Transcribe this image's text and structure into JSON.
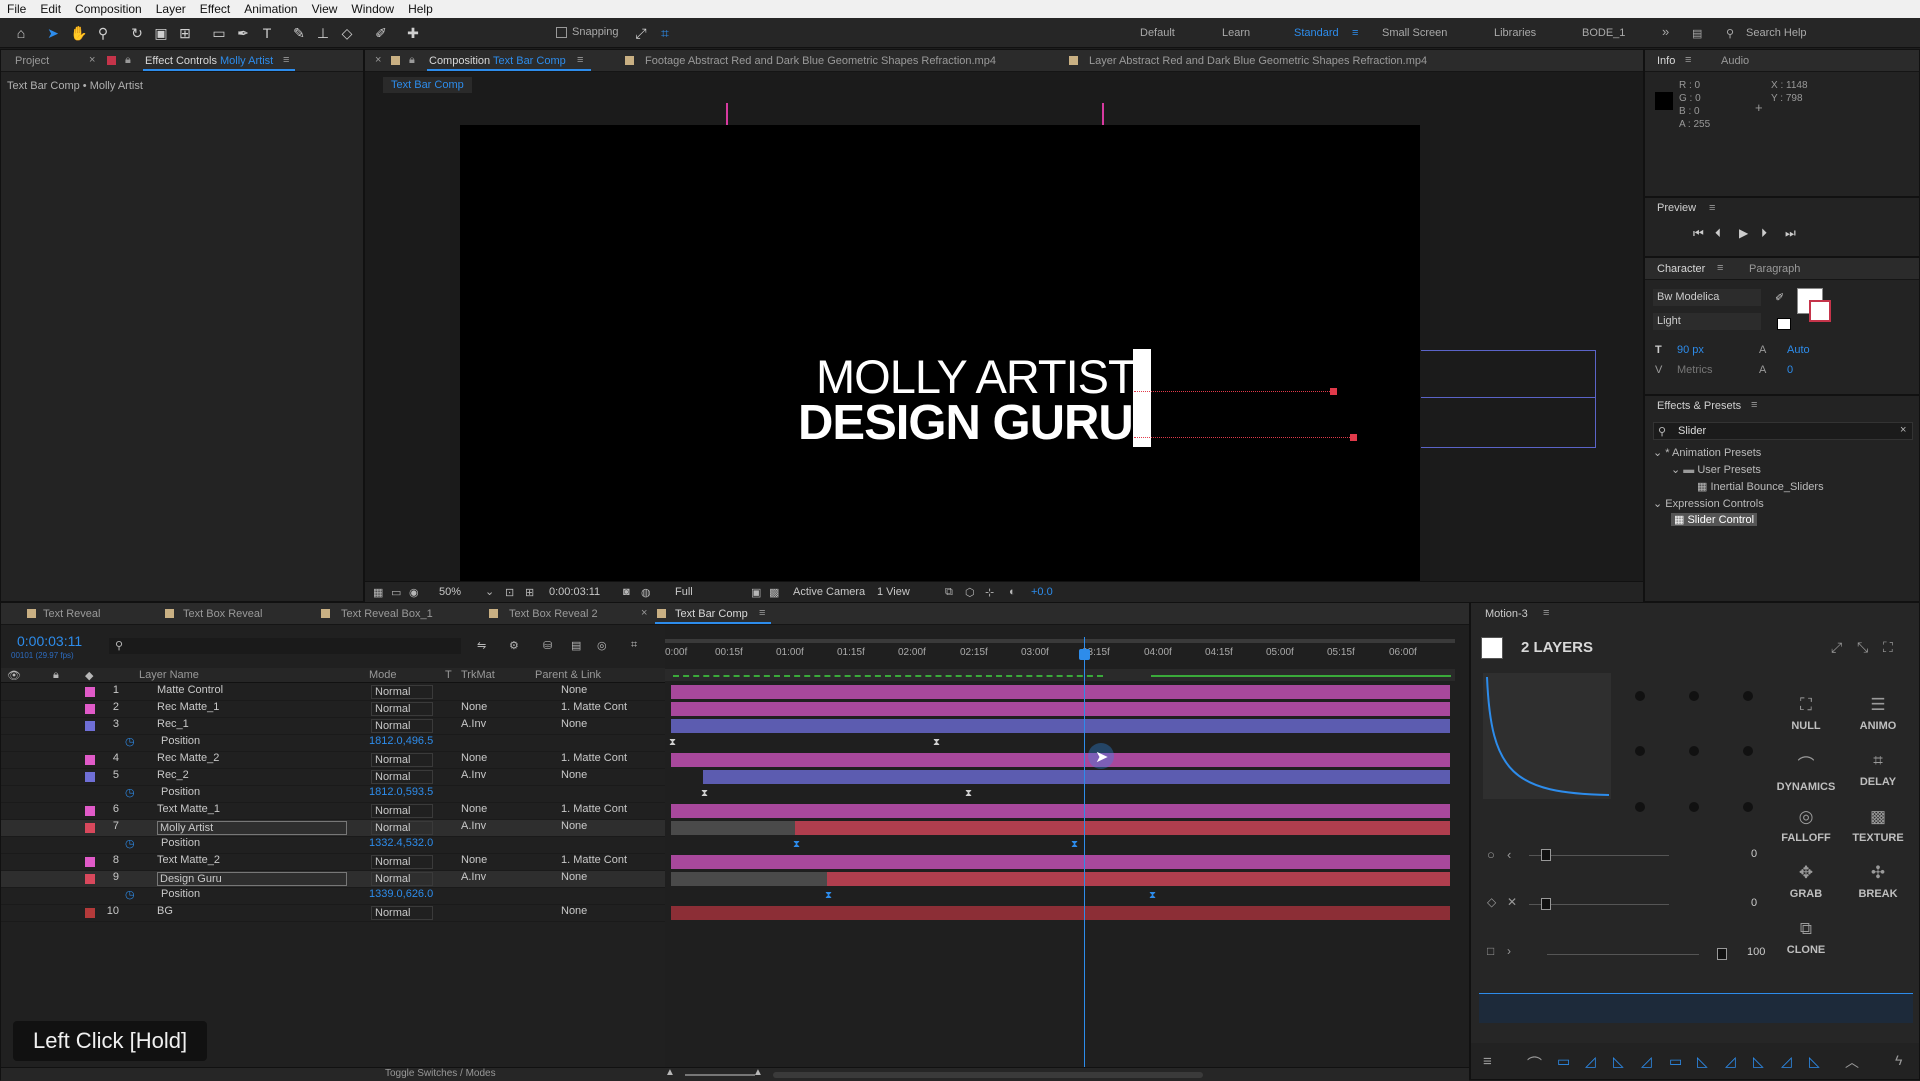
{
  "menu": [
    "File",
    "Edit",
    "Composition",
    "Layer",
    "Effect",
    "Animation",
    "View",
    "Window",
    "Help"
  ],
  "toolbar": {
    "snapping_label": "Snapping",
    "workspaces": [
      "Default",
      "Learn",
      "Standard",
      "Small Screen",
      "Libraries",
      "BODE_1"
    ],
    "active_workspace": "Standard",
    "search_placeholder": "Search Help"
  },
  "left_panel": {
    "tab_project": "Project",
    "tab_effect_controls": "Effect Controls",
    "effect_layer": "Molly Artist",
    "breadcrumb": "Text Bar Comp • Molly Artist"
  },
  "viewer": {
    "tab_composition": "Composition",
    "comp_name": "Text Bar Comp",
    "tab_footage": "Footage  Abstract Red and Dark Blue Geometric Shapes Refraction.mp4",
    "tab_layer": "Layer  Abstract Red and Dark Blue Geometric Shapes Refraction.mp4",
    "subtab": "Text Bar Comp",
    "line1": "MOLLY ARTIST",
    "line2": "DESIGN GURU",
    "zoom": "50%",
    "timecode": "0:00:03:11",
    "resolution": "Full",
    "camera": "Active Camera",
    "views": "1 View",
    "exposure": "+0.0"
  },
  "info": {
    "tab_info": "Info",
    "tab_audio": "Audio",
    "r": "R : 0",
    "g": "G : 0",
    "b": "B : 0",
    "a": "A : 255",
    "x": "X : 1148",
    "y": "Y : 798"
  },
  "preview": {
    "title": "Preview"
  },
  "character": {
    "tab_character": "Character",
    "tab_paragraph": "Paragraph",
    "font": "Bw Modelica",
    "style": "Light",
    "size": "90 px",
    "leading": "Auto",
    "kerning": "Metrics",
    "tracking": "0"
  },
  "effects": {
    "title": "Effects & Presets",
    "search": "Slider",
    "tree": [
      {
        "label": "* Animation Presets",
        "indent": 0
      },
      {
        "label": "User Presets",
        "indent": 1
      },
      {
        "label": "Inertial Bounce_Sliders",
        "indent": 2
      },
      {
        "label": "Expression Controls",
        "indent": 0
      },
      {
        "label": "Slider Control",
        "indent": 1
      }
    ]
  },
  "timeline": {
    "tabs": [
      "Text Reveal",
      "Text Box Reveal",
      "Text Reveal Box_1",
      "Text Box Reveal 2",
      "Text Bar Comp"
    ],
    "active_tab": "Text Bar Comp",
    "timecode": "0:00:03:11",
    "fps": "00101 (29.97 fps)",
    "col_layer_name": "Layer Name",
    "col_mode": "Mode",
    "col_t": "T",
    "col_trkmat": "TrkMat",
    "col_parent": "Parent & Link",
    "ruler": [
      "0:00f",
      "00:15f",
      "01:00f",
      "01:15f",
      "02:00f",
      "02:15f",
      "03:00f",
      "03:15f",
      "04:00f",
      "04:15f",
      "05:00f",
      "05:15f",
      "06:00f"
    ],
    "layers": [
      {
        "num": "1",
        "name": "Matte Control",
        "mode": "Normal",
        "trk": "",
        "parent": "None",
        "color": "#e05ac8",
        "type": "layer"
      },
      {
        "num": "2",
        "name": "Rec Matte_1",
        "mode": "Normal",
        "trk": "None",
        "parent": "1. Matte Cont",
        "color": "#e05ac8",
        "type": "layer"
      },
      {
        "num": "3",
        "name": "Rec_1",
        "mode": "Normal",
        "trk": "A.Inv",
        "parent": "None",
        "color": "#6f6fd6",
        "type": "layer"
      },
      {
        "num": "",
        "name": "Position",
        "value": "1812.0,496.5",
        "type": "prop"
      },
      {
        "num": "4",
        "name": "Rec Matte_2",
        "mode": "Normal",
        "trk": "None",
        "parent": "1. Matte Cont",
        "color": "#e05ac8",
        "type": "layer"
      },
      {
        "num": "5",
        "name": "Rec_2",
        "mode": "Normal",
        "trk": "A.Inv",
        "parent": "None",
        "color": "#6f6fd6",
        "type": "layer"
      },
      {
        "num": "",
        "name": "Position",
        "value": "1812.0,593.5",
        "type": "prop"
      },
      {
        "num": "6",
        "name": "Text Matte_1",
        "mode": "Normal",
        "trk": "None",
        "parent": "1. Matte Cont",
        "color": "#e05ac8",
        "type": "layer"
      },
      {
        "num": "7",
        "name": "Molly Artist",
        "mode": "Normal",
        "trk": "A.Inv",
        "parent": "None",
        "color": "#d8485c",
        "type": "layer"
      },
      {
        "num": "",
        "name": "Position",
        "value": "1332.4,532.0",
        "type": "prop"
      },
      {
        "num": "8",
        "name": "Text Matte_2",
        "mode": "Normal",
        "trk": "None",
        "parent": "1. Matte Cont",
        "color": "#e05ac8",
        "type": "layer"
      },
      {
        "num": "9",
        "name": "Design Guru",
        "mode": "Normal",
        "trk": "A.Inv",
        "parent": "None",
        "color": "#d8485c",
        "type": "layer"
      },
      {
        "num": "",
        "name": "Position",
        "value": "1339.0,626.0",
        "type": "prop"
      },
      {
        "num": "10",
        "name": "BG",
        "mode": "Normal",
        "trk": "",
        "parent": "None",
        "color": "#b43a3a",
        "type": "layer"
      }
    ],
    "toggle_label": "Toggle Switches / Modes",
    "overlay": "Left Click [Hold]"
  },
  "motion": {
    "title": "Motion-3",
    "layers_label": "2 LAYERS",
    "buttons": [
      "NULL",
      "ANIMO",
      "DYNAMICS",
      "DELAY",
      "FALLOFF",
      "TEXTURE",
      "GRAB",
      "BREAK",
      "CLONE"
    ],
    "slider1": "0",
    "slider2": "0",
    "slider3": "100"
  }
}
